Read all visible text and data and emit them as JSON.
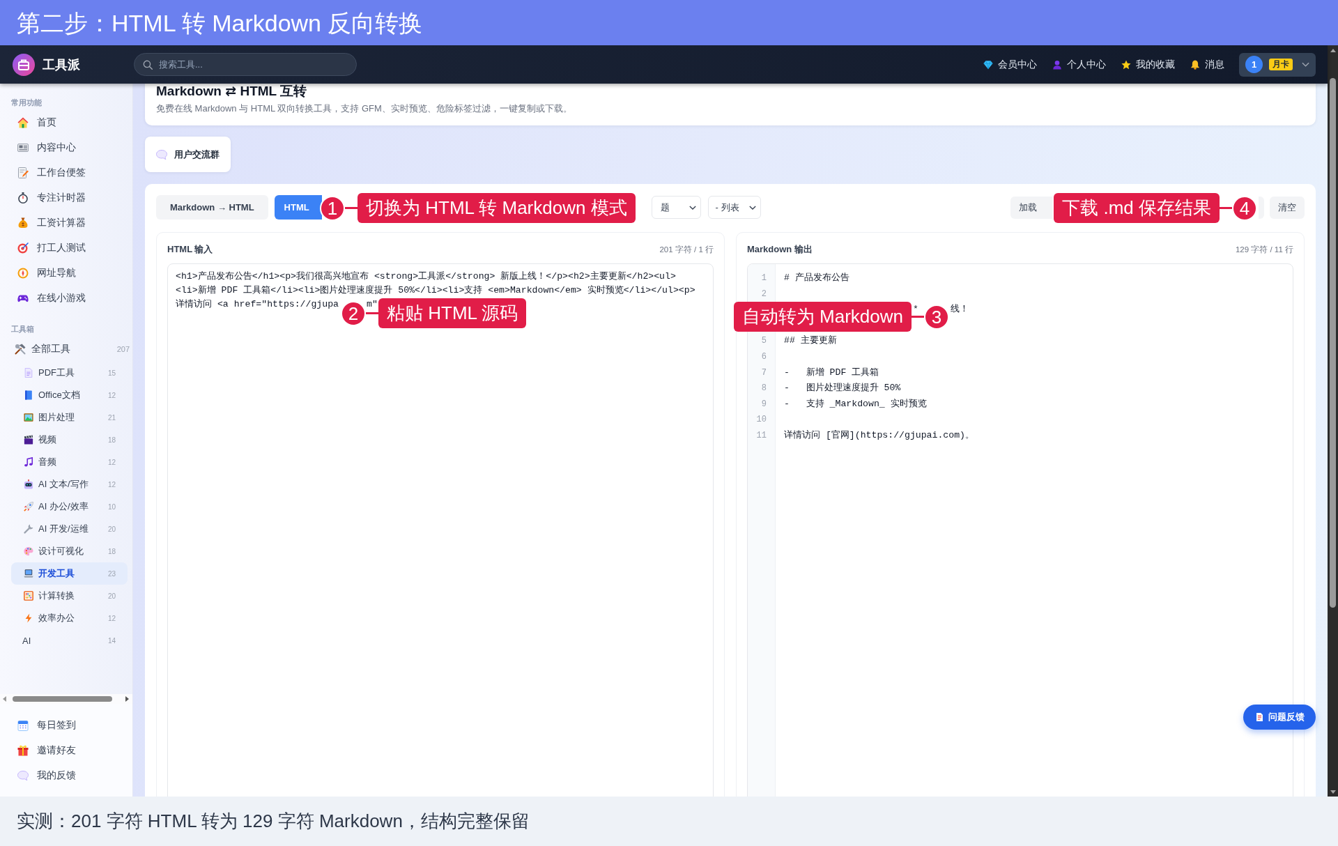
{
  "banner": {
    "title": "第二步：HTML 转 Markdown 反向转换"
  },
  "navbar": {
    "brand": "工具派",
    "search": {
      "placeholder": "搜索工具..."
    },
    "links": [
      {
        "label": "会员中心"
      },
      {
        "label": "个人中心"
      },
      {
        "label": "我的收藏"
      },
      {
        "label": "消息"
      }
    ],
    "user": {
      "avatar": "1",
      "badge": "月卡"
    }
  },
  "sidebar": {
    "sections": [
      {
        "title": "常用功能",
        "items": [
          {
            "label": "首页"
          },
          {
            "label": "内容中心"
          },
          {
            "label": "工作台便签"
          },
          {
            "label": "专注计时器"
          },
          {
            "label": "工资计算器"
          },
          {
            "label": "打工人测试"
          },
          {
            "label": "网址导航"
          },
          {
            "label": "在线小游戏"
          }
        ]
      },
      {
        "title": "工具箱",
        "items": [
          {
            "label": "全部工具",
            "count": "207",
            "children": [
              {
                "kind": "icon",
                "label": "PDF工具",
                "count": "15",
                "selected": false
              },
              {
                "kind": "icon",
                "label": "Office文档",
                "count": "12",
                "selected": false
              },
              {
                "kind": "icon",
                "label": "图片处理",
                "count": "21",
                "selected": false
              },
              {
                "kind": "icon",
                "label": "视频",
                "count": "18",
                "selected": false
              },
              {
                "kind": "icon",
                "label": "音频",
                "count": "12",
                "selected": false
              },
              {
                "kind": "icon",
                "label": "AI 文本/写作",
                "count": "12",
                "selected": false
              },
              {
                "kind": "icon",
                "label": "AI 办公/效率",
                "count": "10",
                "selected": false
              },
              {
                "kind": "icon",
                "label": "AI 开发/运维",
                "count": "20",
                "selected": false
              },
              {
                "kind": "icon",
                "label": "设计可视化",
                "count": "18",
                "selected": false
              },
              {
                "kind": "icon",
                "label": "开发工具",
                "count": "23",
                "selected": true
              },
              {
                "kind": "icon",
                "label": "计算转换",
                "count": "20",
                "selected": false
              },
              {
                "kind": "icon",
                "label": "效率办公",
                "count": "12",
                "selected": false
              },
              {
                "kind": "plain",
                "label": "AI",
                "count": "14",
                "selected": false
              }
            ]
          }
        ]
      }
    ],
    "footer_items": [
      {
        "label": "每日签到"
      },
      {
        "label": "邀请好友"
      },
      {
        "label": "我的反馈"
      }
    ]
  },
  "header": {
    "title": "Markdown ⇄ HTML 互转",
    "subtitle": "免费在线 Markdown 与 HTML 双向转换工具，支持 GFM、实时预览、危险标签过滤，一键复制或下载。"
  },
  "community_button": {
    "label": "用户交流群"
  },
  "toolbar": {
    "modes": [
      {
        "label": "Markdown → HTML",
        "selected": false
      },
      {
        "label": "HTML",
        "selected": true
      }
    ],
    "selects": [
      {
        "value": "题"
      },
      {
        "value": "- 列表"
      }
    ],
    "actions": [
      {
        "kind": "text",
        "label": "加载"
      },
      {
        "kind": "covered"
      },
      {
        "kind": "text",
        "label": "清空"
      }
    ]
  },
  "editors": {
    "input": {
      "title": "HTML 输入",
      "meta": "201 字符 / 1 行",
      "lines": [
        {
          "parts": [
            "<h1>产品发布公告</h1><p>我们很高兴地宣布 <strong>工具派</strong> 新版上线！</p><h2>主要更新</h2><ul>"
          ]
        },
        {
          "parts": [
            "<li>新增 PDF 工具箱</li><li>图片处理速度提升 50%</li><li>支持 <em>Markdown</em> 实时预览</li></ul><p>"
          ]
        },
        {
          "parts": [
            "详情访问 <a href=\"https://gjupa",
            "m\""
          ]
        }
      ]
    },
    "output": {
      "title": "Markdown 输出",
      "meta": "129 字符 / 11 行",
      "lines": [
        {
          "kind": "code",
          "number": "1",
          "text": "# 产品发布公告"
        },
        {
          "kind": "blank",
          "number": "2"
        },
        {
          "kind": "covered",
          "parts": [
            "*",
            "线！"
          ]
        },
        {
          "kind": "covered"
        },
        {
          "kind": "code",
          "number": "5",
          "text": "## 主要更新"
        },
        {
          "kind": "blank",
          "number": "6"
        },
        {
          "kind": "code",
          "number": "7",
          "text": "-   新增 PDF 工具箱"
        },
        {
          "kind": "code",
          "number": "8",
          "text": "-   图片处理速度提升 50%"
        },
        {
          "kind": "code",
          "number": "9",
          "text": "-   支持 _Markdown_ 实时预览"
        },
        {
          "kind": "blank",
          "number": "10"
        },
        {
          "kind": "code",
          "number": "11",
          "text": "详情访问 [官网](https://gjupai.com)。"
        }
      ]
    }
  },
  "floating_button": {
    "label": "问题反馈"
  },
  "annotations": [
    {
      "number": "1",
      "label": "切换为 HTML 转 Markdown 模式"
    },
    {
      "number": "2",
      "label": "粘贴 HTML 源码"
    },
    {
      "number": "3",
      "label": "自动转为 Markdown"
    },
    {
      "number": "4",
      "label": "下载 .md 保存结果"
    }
  ],
  "caption": {
    "text": "实测：201 字符 HTML 转为 129 字符 Markdown，结构完整保留"
  }
}
